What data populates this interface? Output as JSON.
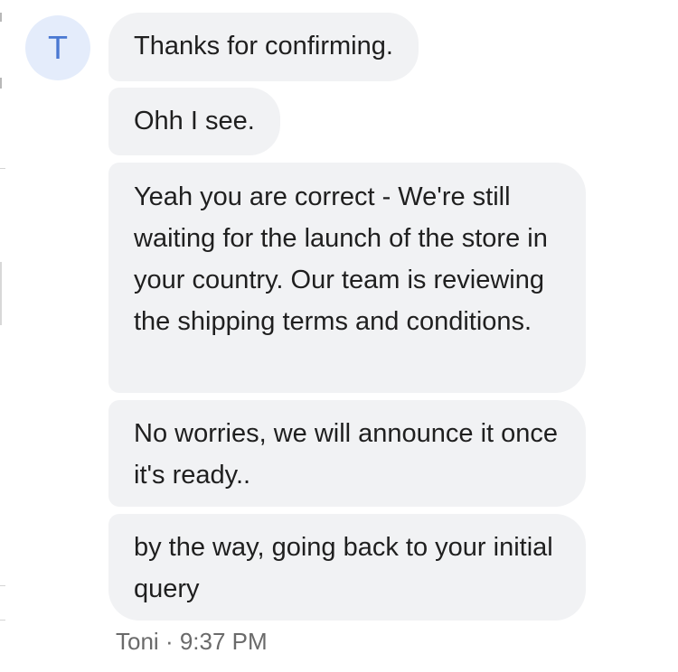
{
  "sender": {
    "avatar_initial": "T",
    "name": "Toni",
    "time": "9:37 PM",
    "separator": "·"
  },
  "messages": [
    {
      "text": "Thanks for confirming."
    },
    {
      "text": "Ohh I see."
    },
    {
      "text": "Yeah you are correct - We're still waiting for the launch of the store in your country. Our team is reviewing the shipping terms and conditions."
    },
    {
      "text": "No worries, we will announce it once it's ready.."
    },
    {
      "text": "by the way, going back to your initial query"
    }
  ],
  "colors": {
    "bubble": "#f1f2f4",
    "avatar_bg": "#e4ecfb",
    "avatar_text": "#4a78d2",
    "meta_text": "#6a6a6a"
  }
}
